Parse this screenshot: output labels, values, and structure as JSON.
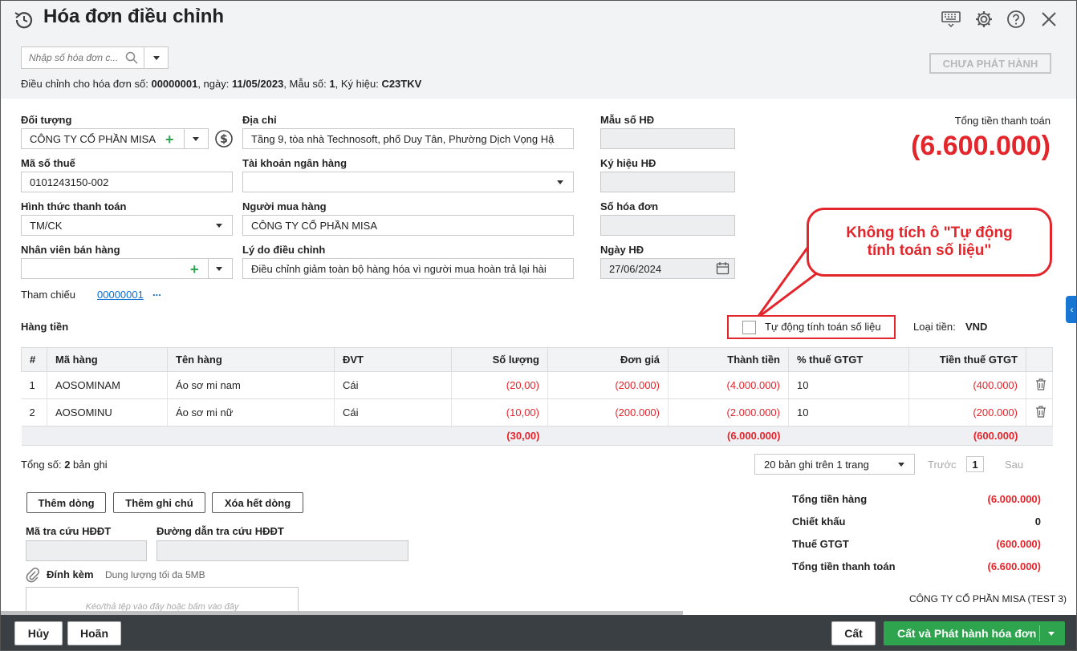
{
  "window": {
    "title": "Hóa đơn điều chỉnh"
  },
  "header": {
    "search_placeholder": "Nhập số hóa đơn c...",
    "subtitle": {
      "prefix": "Điều chỉnh cho hóa đơn số: ",
      "invoice_no": "00000001",
      "date_prefix": ", ngày: ",
      "date": "11/05/2023",
      "form_prefix": ", Mẫu số: ",
      "form": "1",
      "symbol_prefix": ", Ký hiệu: ",
      "symbol": "C23TKV"
    },
    "status_label": "CHƯA PHÁT HÀNH",
    "toolbar_icons": [
      "keyboard-icon",
      "gear-icon",
      "help-icon",
      "close-icon"
    ]
  },
  "form": {
    "doi_tuong": {
      "label": "Đối tượng",
      "value": "CÔNG TY CỔ PHẦN MISA"
    },
    "dia_chi": {
      "label": "Địa chỉ",
      "value": "Tầng 9, tòa nhà Technosoft, phố Duy Tân, Phường Dịch Vọng Hậ"
    },
    "mau_so": {
      "label": "Mẫu số HĐ",
      "value": ""
    },
    "ma_so_thue": {
      "label": "Mã số thuế",
      "value": "0101243150-002"
    },
    "tai_khoan": {
      "label": "Tài khoản ngân hàng",
      "value": ""
    },
    "ky_hieu": {
      "label": "Ký hiệu HĐ",
      "value": ""
    },
    "hinh_thuc": {
      "label": "Hình thức thanh toán",
      "value": "TM/CK"
    },
    "nguoi_mua": {
      "label": "Người mua hàng",
      "value": "CÔNG TY CỔ PHẦN MISA"
    },
    "so_hoa_don": {
      "label": "Số hóa đơn",
      "value": ""
    },
    "nhan_vien": {
      "label": "Nhân viên bán hàng",
      "value": ""
    },
    "ly_do": {
      "label": "Lý do điều chỉnh",
      "value": "Điều chỉnh giảm toàn bộ hàng hóa vì người mua hoàn trả lại hài"
    },
    "ngay_hd": {
      "label": "Ngày HĐ",
      "value": "27/06/2024"
    },
    "tham_chieu": {
      "label": "Tham chiếu",
      "link": "00000001",
      "more": "..."
    }
  },
  "total": {
    "label": "Tổng tiền thanh toán",
    "value": "(6.600.000)"
  },
  "callout": "Không tích ô \"Tự động tính toán số liệu\"",
  "items_section": {
    "title": "Hàng tiền",
    "auto_calc_label": "Tự động tính toán số liệu",
    "auto_calc_checked": false,
    "currency_label": "Loại tiền:",
    "currency": "VND"
  },
  "table": {
    "columns": [
      "#",
      "Mã hàng",
      "Tên hàng",
      "ĐVT",
      "Số lượng",
      "Đơn giá",
      "Thành tiền",
      "% thuế GTGT",
      "Tiền thuế GTGT"
    ],
    "rows": [
      [
        "1",
        "AOSOMINAM",
        "Áo sơ mi nam",
        "Cái",
        "(20,00)",
        "(200.000)",
        "(4.000.000)",
        "10",
        "(400.000)"
      ],
      [
        "2",
        "AOSOMINU",
        "Áo sơ mi nữ",
        "Cái",
        "(10,00)",
        "(200.000)",
        "(2.000.000)",
        "10",
        "(200.000)"
      ]
    ],
    "footer": {
      "so_luong": "(30,00)",
      "thanh_tien": "(6.000.000)",
      "tien_thue": "(600.000)"
    }
  },
  "pagination": {
    "count_prefix": "Tổng số: ",
    "count": "2",
    "count_suffix": " bản ghi",
    "page_size": "20 bản ghi trên 1 trang",
    "prev": "Trước",
    "page": "1",
    "next": "Sau"
  },
  "actions": {
    "add_row": "Thêm dòng",
    "add_note": "Thêm ghi chú",
    "delete_all": "Xóa hết dòng"
  },
  "lookup": {
    "code_label": "Mã tra cứu HĐĐT",
    "code_value": "",
    "url_label": "Đường dẫn tra cứu HĐĐT",
    "url_value": ""
  },
  "attachment": {
    "label": "Đính kèm",
    "hint": "Dung lượng tối đa 5MB",
    "drop_text": "Kéo/thả tệp vào đây hoặc bấm vào đây"
  },
  "summary": [
    {
      "label": "Tổng tiền hàng",
      "value": "(6.000.000)"
    },
    {
      "label": "Chiết khấu",
      "value": "0"
    },
    {
      "label": "Thuế GTGT",
      "value": "(600.000)"
    },
    {
      "label": "Tổng tiền thanh toán",
      "value": "(6.600.000)"
    }
  ],
  "company": "CÔNG TY CỔ PHẦN MISA (TEST 3)",
  "footer": {
    "cancel": "Hủy",
    "defer": "Hoãn",
    "save": "Cất",
    "save_issue": "Cất và Phát hành hóa đơn"
  },
  "colors": {
    "accent_red": "#e3262c",
    "primary_green": "#2ea44f",
    "footer_bg": "#3a3f44"
  }
}
